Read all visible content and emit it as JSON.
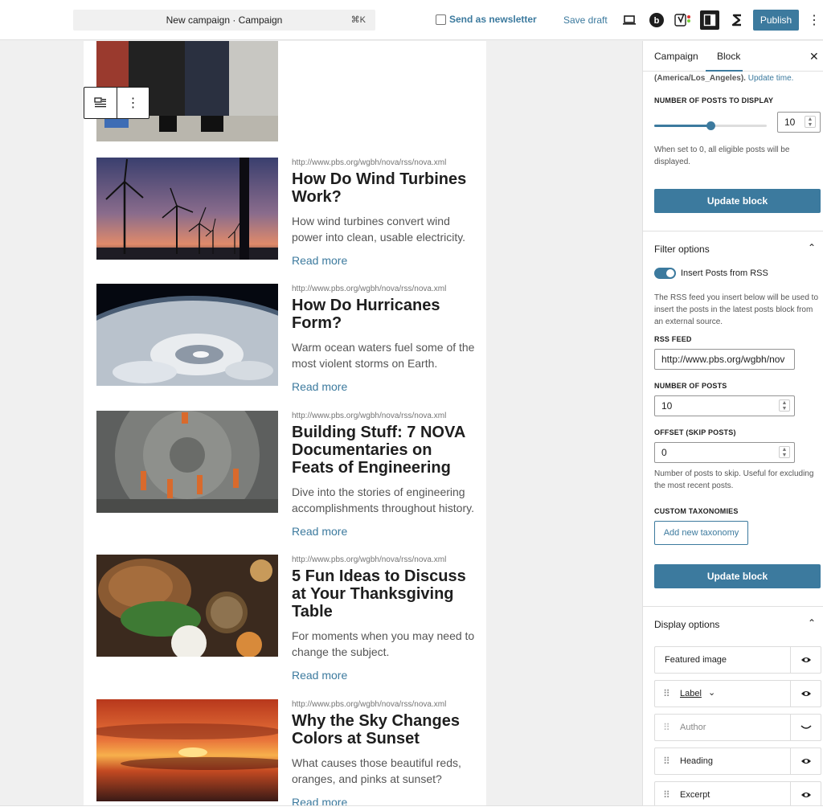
{
  "topbar": {
    "doc_title": "New campaign · Campaign",
    "shortcut": "⌘K",
    "newsletter_label": "Send as newsletter",
    "save_draft": "Save draft",
    "publish": "Publish"
  },
  "posts": [
    {
      "source": "",
      "title": "",
      "excerpt": "",
      "read_more": ""
    },
    {
      "source": "http://www.pbs.org/wgbh/nova/rss/nova.xml",
      "title": "How Do Wind Turbines Work?",
      "excerpt": "How wind turbines convert wind power into clean, usable electricity.",
      "read_more": "Read more"
    },
    {
      "source": "http://www.pbs.org/wgbh/nova/rss/nova.xml",
      "title": "How Do Hurricanes Form?",
      "excerpt": "Warm ocean waters fuel some of the most violent storms on Earth.",
      "read_more": "Read more"
    },
    {
      "source": "http://www.pbs.org/wgbh/nova/rss/nova.xml",
      "title": "Building Stuff: 7 NOVA Documentaries on Feats of Engineering",
      "excerpt": "Dive into the stories of engineering accomplishments throughout history.",
      "read_more": "Read more"
    },
    {
      "source": "http://www.pbs.org/wgbh/nova/rss/nova.xml",
      "title": "5 Fun Ideas to Discuss at Your Thanksgiving Table",
      "excerpt": "For moments when you may need to change the subject.",
      "read_more": "Read more"
    },
    {
      "source": "http://www.pbs.org/wgbh/nova/rss/nova.xml",
      "title": "Why the Sky Changes Colors at Sunset",
      "excerpt": "What causes those beautiful reds, oranges, and pinks at sunset?",
      "read_more": "Read more"
    }
  ],
  "sidebar": {
    "tab_campaign": "Campaign",
    "tab_block": "Block",
    "timezone": "(America/Los_Angeles).",
    "update_time": "Update time.",
    "num_display_label": "NUMBER OF POSTS TO DISPLAY",
    "num_display_value": "10",
    "num_display_fraction": 0.5,
    "num_display_help": "When set to 0, all eligible posts will be displayed.",
    "update_block": "Update block",
    "filter_header": "Filter options",
    "rss_toggle_label": "Insert Posts from RSS",
    "rss_help": "The RSS feed you insert below will be used to insert the posts in the latest posts block from an external source.",
    "rss_feed_label": "RSS FEED",
    "rss_feed_value": "http://www.pbs.org/wgbh/nov",
    "num_posts_label": "NUMBER OF POSTS",
    "num_posts_value": "10",
    "offset_label": "OFFSET (SKIP POSTS)",
    "offset_value": "0",
    "offset_help": "Number of posts to skip. Useful for excluding the most recent posts.",
    "taxonomies_label": "CUSTOM TAXONOMIES",
    "add_taxonomy": "Add new taxonomy",
    "display_header": "Display options",
    "display_items": [
      {
        "label": "Featured image"
      },
      {
        "label": "Label"
      },
      {
        "label": "Author"
      },
      {
        "label": "Heading"
      },
      {
        "label": "Excerpt"
      }
    ]
  },
  "colors": {
    "accent": "#3c7a9e",
    "toggle_on": "#3c7a9e"
  }
}
